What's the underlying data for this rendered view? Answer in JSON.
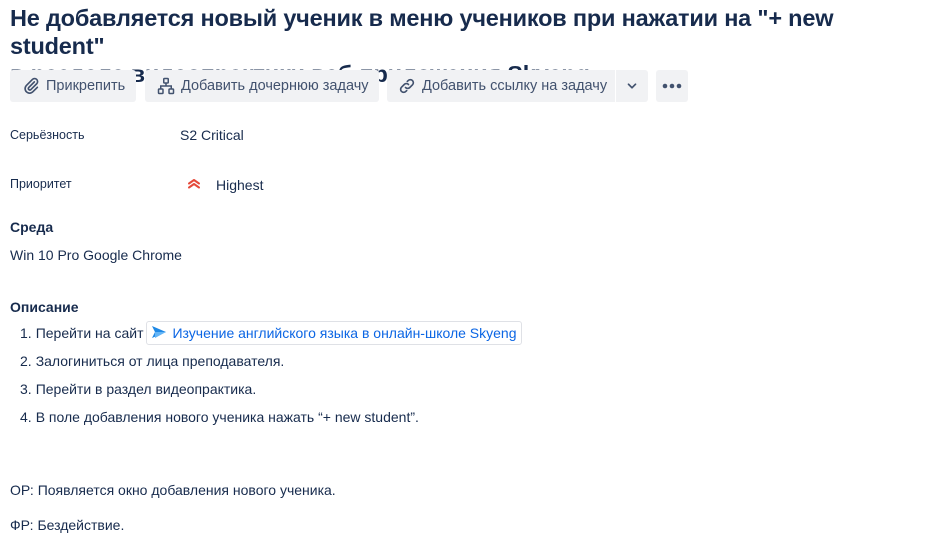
{
  "issue": {
    "title_line1": "Не добавляется новый ученик в меню учеников при нажатии на \"+ new student\"",
    "title_line2": "в разделе видеопрактики веб-приложения Skyeng"
  },
  "toolbar": {
    "attach_label": "Прикрепить",
    "add_child_label": "Добавить дочернюю задачу",
    "add_link_label": "Добавить ссылку на задачу"
  },
  "fields": {
    "severity_label": "Серьёзность",
    "severity_value": "S2 Critical",
    "priority_label": "Приоритет",
    "priority_value": "Highest",
    "priority_color": "#e5493a"
  },
  "environment": {
    "heading": "Среда",
    "value": "Win 10 Pro Google Chrome"
  },
  "description": {
    "heading": "Описание",
    "steps": [
      {
        "num": "1.",
        "text": "Перейти на сайт",
        "link": "Изучение английского языка в онлайн-школе Skyeng"
      },
      {
        "num": "2.",
        "text": "Залогиниться от лица преподавателя."
      },
      {
        "num": "3.",
        "text": "Перейти в раздел видеопрактика."
      },
      {
        "num": "4.",
        "text": "В поле добавления нового ученика нажать “+ new student”."
      }
    ],
    "expected": "ОР: Появляется окно добавления нового ученика.",
    "actual": "ФР: Бездействие."
  },
  "colors": {
    "link": "#0c66e4",
    "button_bg": "#f1f2f4",
    "text": "#172b4d"
  }
}
